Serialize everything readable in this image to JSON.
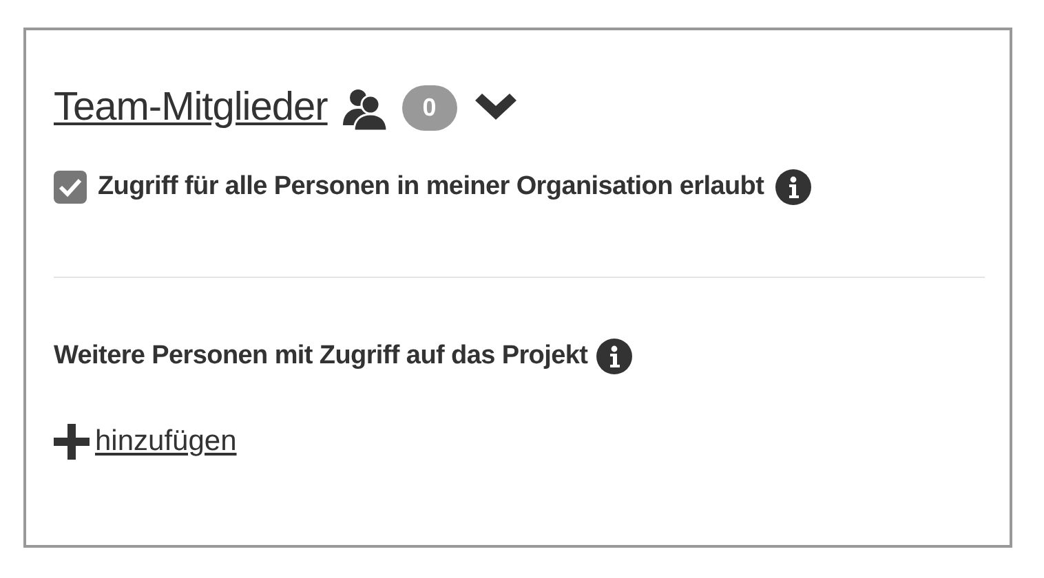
{
  "team": {
    "title": "Team-Mitglieder",
    "count": "0",
    "expanded": true
  },
  "org_access": {
    "label": "Zugriff für alle Personen in meiner Organisation erlaubt",
    "checked": true
  },
  "more_people": {
    "heading": "Weitere Personen mit Zugriff auf das Projekt",
    "add_link": "hinzufügen"
  }
}
